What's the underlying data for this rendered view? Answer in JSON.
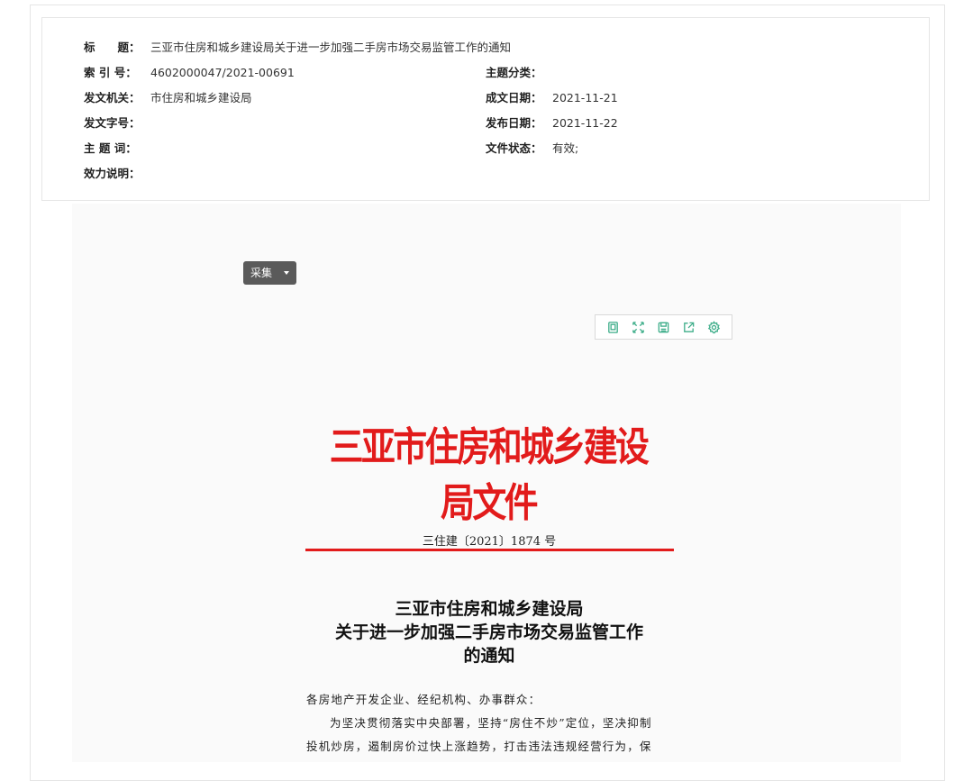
{
  "meta": {
    "title_label": "标　　题：",
    "title_value": "三亚市住房和城乡建设局关于进一步加强二手房市场交易监管工作的通知",
    "index_label": "索 引 号：",
    "index_value": "4602000047/2021-00691",
    "category_label": "主题分类：",
    "category_value": "",
    "issuer_label": "发文机关：",
    "issuer_value": "市住房和城乡建设局",
    "written_date_label": "成文日期：",
    "written_date_value": "2021-11-21",
    "doc_code_label": "发文字号：",
    "doc_code_value": "",
    "publish_date_label": "发布日期：",
    "publish_date_value": "2021-11-22",
    "keywords_label": "主 题 词：",
    "keywords_value": "",
    "status_label": "文件状态：",
    "status_value": "有效;",
    "validity_label": "效力说明：",
    "validity_value": ""
  },
  "collect_button": {
    "label": "采集"
  },
  "toolbar": {
    "icons": [
      "page-icon",
      "fullscreen-icon",
      "save-icon",
      "share-icon",
      "settings-icon"
    ],
    "color": "#3fae8a"
  },
  "document": {
    "header": "三亚市住房和城乡建设局文件",
    "number": "三住建〔2021〕1874 号",
    "title_line1": "三亚市住房和城乡建设局",
    "title_line2": "关于进一步加强二手房市场交易监管工作",
    "title_line3": "的通知",
    "salutation": "各房地产开发企业、经纪机构、办事群众：",
    "para_line1": "为坚决贯彻落实中央部署，坚持“房住不炒”定位，坚决抑制",
    "para_line2": "投机炒房，遏制房价过快上涨趋势，打击违法违规经营行为，保",
    "accent_color": "#e21b1b"
  }
}
